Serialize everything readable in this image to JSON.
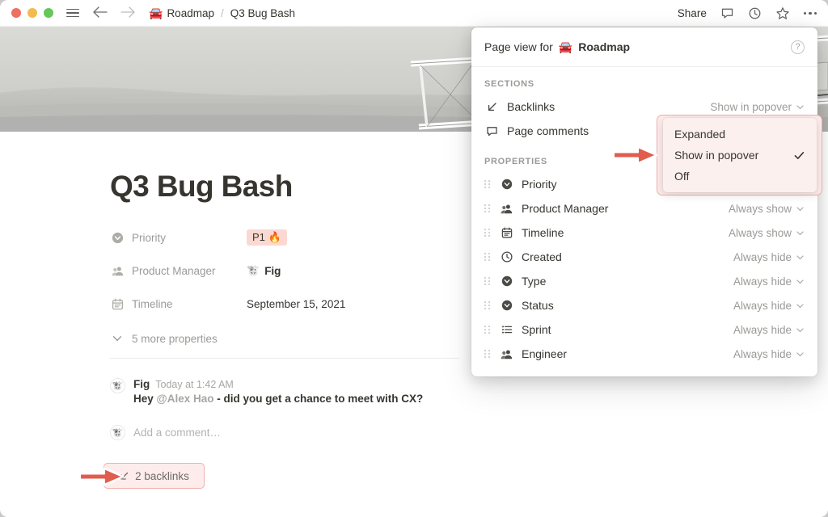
{
  "titlebar": {
    "traffic": [
      "close",
      "minimize",
      "zoom"
    ],
    "menu_icon": "hamburger-icon",
    "back_icon": "←",
    "forward_icon": "→",
    "breadcrumb": {
      "parent_emoji": "🚘",
      "parent": "Roadmap",
      "separator": "/",
      "current": "Q3 Bug Bash"
    },
    "share_label": "Share",
    "icons": [
      "comment-icon",
      "history-icon",
      "favorite-star-icon",
      "more-options-icon"
    ]
  },
  "page": {
    "title": "Q3 Bug Bash",
    "properties": [
      {
        "icon": "select-icon",
        "label": "Priority",
        "value": "P1 🔥",
        "value_type": "badge"
      },
      {
        "icon": "person-icon",
        "label": "Product Manager",
        "value": "Fig",
        "value_type": "person",
        "avatar": "🐮"
      },
      {
        "icon": "calendar-icon",
        "label": "Timeline",
        "value": "September 15, 2021",
        "value_type": "text"
      }
    ],
    "more_properties_label": "5 more properties",
    "comment": {
      "avatar": "🐮",
      "author": "Fig",
      "time": "Today at 1:42 AM",
      "body_prefix": "Hey ",
      "mention": "@Alex Hao",
      "body_suffix": " - did you get a chance to meet with CX?"
    },
    "add_comment_placeholder": "Add a comment…",
    "add_comment_avatar": "🐮",
    "backlinks_label": "2 backlinks",
    "backlinks_icon": "backlink-arrow-icon"
  },
  "popover": {
    "header_prefix": "Page view for ",
    "header_emoji": "🚘",
    "header_target": "Roadmap",
    "help_icon": "?",
    "sections_header": "SECTIONS",
    "sections": [
      {
        "icon": "backlink-arrow-icon",
        "label": "Backlinks",
        "control": "Show in popover"
      },
      {
        "icon": "comment-icon",
        "label": "Page comments",
        "control": ""
      }
    ],
    "properties_header": "PROPERTIES",
    "properties": [
      {
        "icon": "select-icon",
        "label": "Priority",
        "control": ""
      },
      {
        "icon": "person-icon",
        "label": "Product Manager",
        "control": "Always show"
      },
      {
        "icon": "calendar-icon",
        "label": "Timeline",
        "control": "Always show"
      },
      {
        "icon": "clock-icon",
        "label": "Created",
        "control": "Always hide"
      },
      {
        "icon": "select-icon",
        "label": "Type",
        "control": "Always hide"
      },
      {
        "icon": "select-icon",
        "label": "Status",
        "control": "Always hide"
      },
      {
        "icon": "list-icon",
        "label": "Sprint",
        "control": "Always hide"
      },
      {
        "icon": "person-icon",
        "label": "Engineer",
        "control": "Always hide"
      }
    ]
  },
  "dropdown": {
    "items": [
      {
        "label": "Expanded",
        "checked": false
      },
      {
        "label": "Show in popover",
        "checked": true
      },
      {
        "label": "Off",
        "checked": false
      }
    ]
  },
  "annotations": {
    "arrow_color": "#e05c4f",
    "highlight_border": "#f0b1aa",
    "highlight_fill": "#fdeceb"
  }
}
